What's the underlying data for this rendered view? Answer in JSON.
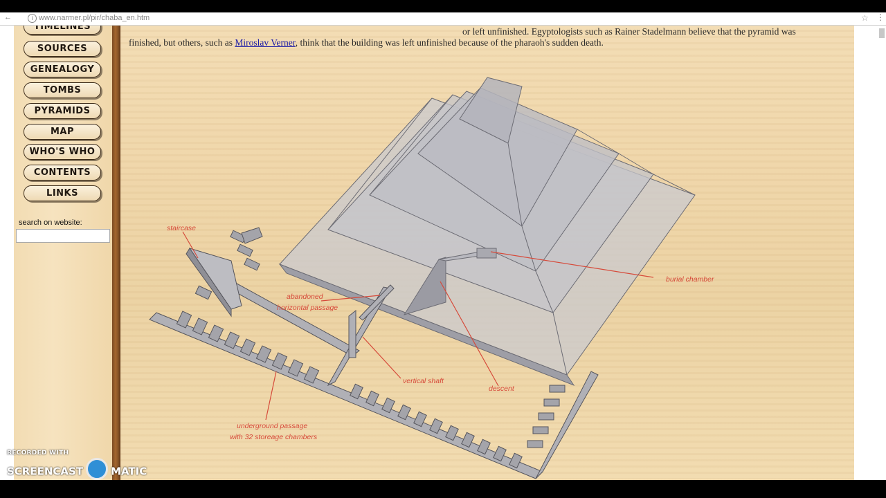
{
  "browser": {
    "url": "www.narmer.pl/pir/chaba_en.htm"
  },
  "sidebar": {
    "partial_item": "TIMELINES",
    "items": [
      "SOURCES",
      "GENEALOGY",
      "TOMBS",
      "PYRAMIDS",
      "MAP",
      "WHO'S WHO",
      "CONTENTS",
      "LINKS"
    ],
    "search_label": "search on website:",
    "search_value": ""
  },
  "article": {
    "line1": "or left unfinished. Egyptologists such as Rainer Stadelmann believe that the pyramid was",
    "line2_before": "finished, but others, such as ",
    "line2_link": "Miroslav Verner",
    "line2_after": ", think that the building was left unfinished because of the pharaoh's sudden death."
  },
  "diagram": {
    "labels": {
      "staircase": "staircase",
      "abandoned_1": "abandoned",
      "abandoned_2": "horizontal passage",
      "burial_chamber": "burial chamber",
      "vertical_shaft": "vertical shaft",
      "descent": "descent",
      "underground_1": "underground passage",
      "underground_2": "with 32 storeage chambers"
    },
    "colors": {
      "stone": "#b8b8bc",
      "label": "#d64a3a",
      "leader": "#d64a3a"
    }
  },
  "watermark": {
    "recorded_with": "RECORDED WITH",
    "brand_left": "SCREENCAST",
    "brand_right": "MATIC"
  }
}
